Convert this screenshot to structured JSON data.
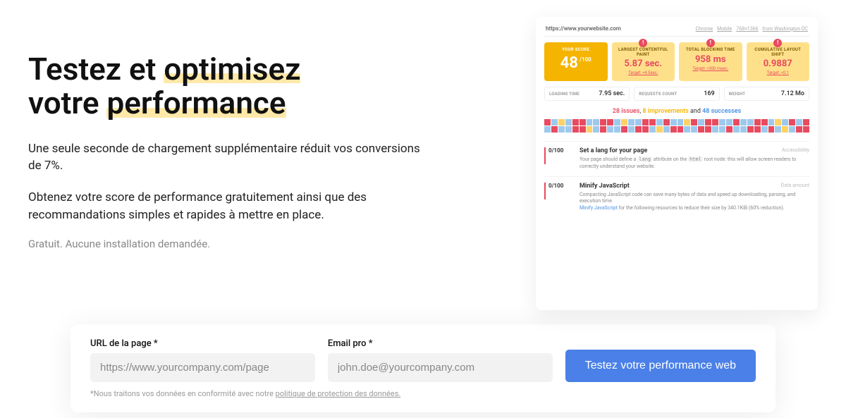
{
  "hero": {
    "title_part1": "Testez et ",
    "title_hl1": "optimisez",
    "title_part2": "votre ",
    "title_hl2": "performance",
    "para1": "Une seule seconde de chargement supplémentaire réduit vos conversions de 7%.",
    "para2": "Obtenez votre score de performance gratuitement ainsi que des recommandations simples et rapides à mettre en place.",
    "sub": "Gratuit. Aucune installation demandée."
  },
  "mock": {
    "url": "https://www.yourwebsite.com",
    "meta": [
      "Chrome",
      "Mobile",
      "768×1366",
      "from Washington DC"
    ],
    "score_card": {
      "label": "YOUR SCORE",
      "value": "48",
      "unit": "/100"
    },
    "metric_cards": [
      {
        "label": "LARGEST CONTENTFUL PAINT",
        "value": "5.87 sec.",
        "target": "Target: <4.5sec."
      },
      {
        "label": "TOTAL BLOCKING TIME",
        "value": "958 ms",
        "target": "Target: <300 msec."
      },
      {
        "label": "CUMULATIVE LAYOUT SHIFT",
        "value": "0.9887",
        "target": "Target: <0.1"
      }
    ],
    "minis": [
      {
        "label": "LOADING TIME",
        "value": "7.95 sec."
      },
      {
        "label": "REQUESTS COUNT",
        "value": "169"
      },
      {
        "label": "WEIGHT",
        "value": "7.12 Mo"
      }
    ],
    "summary": {
      "issues": "28 issues",
      "improvements": "8 improvements",
      "and": " and ",
      "successes": "48 successes"
    },
    "issues": [
      {
        "score": "0/100",
        "title": "Set a lang for your page",
        "category": "Accessibility",
        "desc_pre": "Your page should define a ",
        "desc_code1": "lang",
        "desc_mid": " attribute on the ",
        "desc_code2": "html",
        "desc_post": " root node: this will allow screen readers to correctly understand your website."
      },
      {
        "score": "0/100",
        "title": "Minify JavaScript",
        "category": "Data amount",
        "desc1": "Compacting JavaScript code can save many bytes of data and speed up downloading, parsing, and execution time.",
        "link": "Minify JavaScript",
        "desc2": " for the following resources to reduce their size by 340.1KiB (60% reduction)."
      }
    ]
  },
  "form": {
    "url_label": "URL de la page *",
    "url_placeholder": "https://www.yourcompany.com/page",
    "email_label": "Email pro *",
    "email_placeholder": "john.doe@yourcompany.com",
    "button": "Testez votre performance web",
    "note_pre": "*Nous traitons vos données en conformité avec notre ",
    "note_link": "politique de protection des données."
  },
  "grid_pattern": "rbybrrbbrrbybbrrbrbbyrbrrbbrbbrrbybrbrbrbbrrybrbbrbrrbybrrbbrrbbrbbrrbrbybr"
}
